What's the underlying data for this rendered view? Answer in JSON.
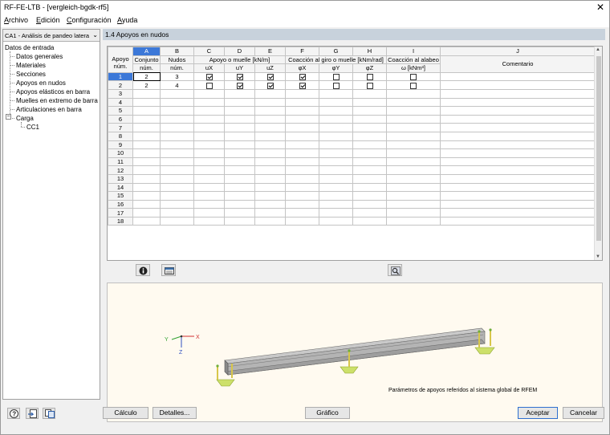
{
  "window": {
    "title": "RF-FE-LTB - [vergleich-bgdk-rf5]",
    "close_glyph": "✕"
  },
  "menu": [
    "Archivo",
    "Edición",
    "Configuración",
    "Ayuda"
  ],
  "sidebar": {
    "case_select": "CA1 - Análisis de pandeo latera",
    "root": "Datos de entrada",
    "items": [
      "Datos generales",
      "Materiales",
      "Secciones",
      "Apoyos en nudos",
      "Apoyos elásticos en barra",
      "Muelles en extremo de barra",
      "Articulaciones en barra"
    ],
    "load_group": "Carga",
    "load_item": "CC1"
  },
  "section_title": "1.4 Apoyos en nudos",
  "table": {
    "letters": [
      "A",
      "B",
      "C",
      "D",
      "E",
      "F",
      "G",
      "H",
      "I",
      "J"
    ],
    "corner": [
      "Apoyo",
      "núm."
    ],
    "col_A": [
      "Conjunto",
      "núm."
    ],
    "col_B": [
      "Nudos",
      "núm."
    ],
    "group_CDE": "Apoyo o muelle [kN/m]",
    "group_FGH": "Coacción al giro o muelle [kNm/rad]",
    "col_I_top": "Coacción al alabeo",
    "col_I_sub": "ω [kNm³]",
    "col_J": "Comentario",
    "sub_CDE": [
      "uX",
      "uY",
      "uZ"
    ],
    "sub_FGH": [
      "φX",
      "φY",
      "φZ"
    ],
    "row_numbers": [
      "1",
      "2",
      "3",
      "4",
      "5",
      "6",
      "7",
      "8",
      "9",
      "10",
      "11",
      "12",
      "13",
      "14",
      "15",
      "16",
      "17",
      "18"
    ],
    "rows": [
      {
        "set": "2",
        "nodes": "3",
        "checks": [
          true,
          true,
          true,
          true,
          false,
          false,
          false
        ]
      },
      {
        "set": "2",
        "nodes": "4",
        "checks": [
          false,
          true,
          true,
          true,
          false,
          false,
          false
        ]
      }
    ]
  },
  "graphic": {
    "caption": "Parámetros de apoyos referidos al sistema global de RFEM",
    "axes": {
      "x": "X",
      "y": "Y",
      "z": "Z"
    }
  },
  "buttons": {
    "calc": "Cálculo",
    "details": "Detalles...",
    "graphic": "Gráfico",
    "accept": "Aceptar",
    "cancel": "Cancelar"
  },
  "icons": [
    "info-icon",
    "import-icon",
    "zoom-view-icon",
    "help-icon",
    "export-icon",
    "copy-icon"
  ]
}
